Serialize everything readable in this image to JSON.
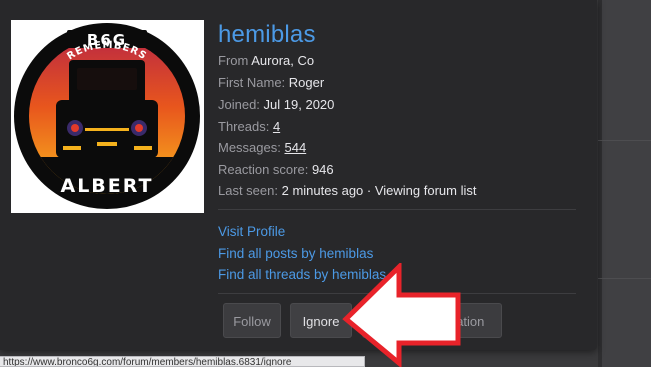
{
  "profile": {
    "username": "hemiblas",
    "from_label": "From",
    "from_value": "Aurora, Co",
    "first_name_label": "First Name:",
    "first_name_value": "Roger",
    "joined_label": "Joined:",
    "joined_value": "Jul 19, 2020",
    "threads_label": "Threads:",
    "threads_value": "4",
    "messages_label": "Messages:",
    "messages_value": "544",
    "reaction_label": "Reaction score:",
    "reaction_value": "946",
    "last_seen_label": "Last seen:",
    "last_seen_value": "2 minutes ago · Viewing forum list"
  },
  "avatar": {
    "top_text": "B6G",
    "arc_text": "REMEMBERS",
    "name_text": "ALBERT"
  },
  "links": {
    "visit_profile": "Visit Profile",
    "find_posts": "Find all posts by hemiblas",
    "find_threads": "Find all threads by hemiblas"
  },
  "buttons": {
    "follow": "Follow",
    "ignore": "Ignore",
    "conversation": "Start conversation"
  },
  "status_bar": {
    "url": "https://www.bronco6g.com/forum/members/hemiblas.6831/ignore"
  },
  "colors": {
    "link": "#4c9ae6",
    "arrow": "#e8232a"
  }
}
